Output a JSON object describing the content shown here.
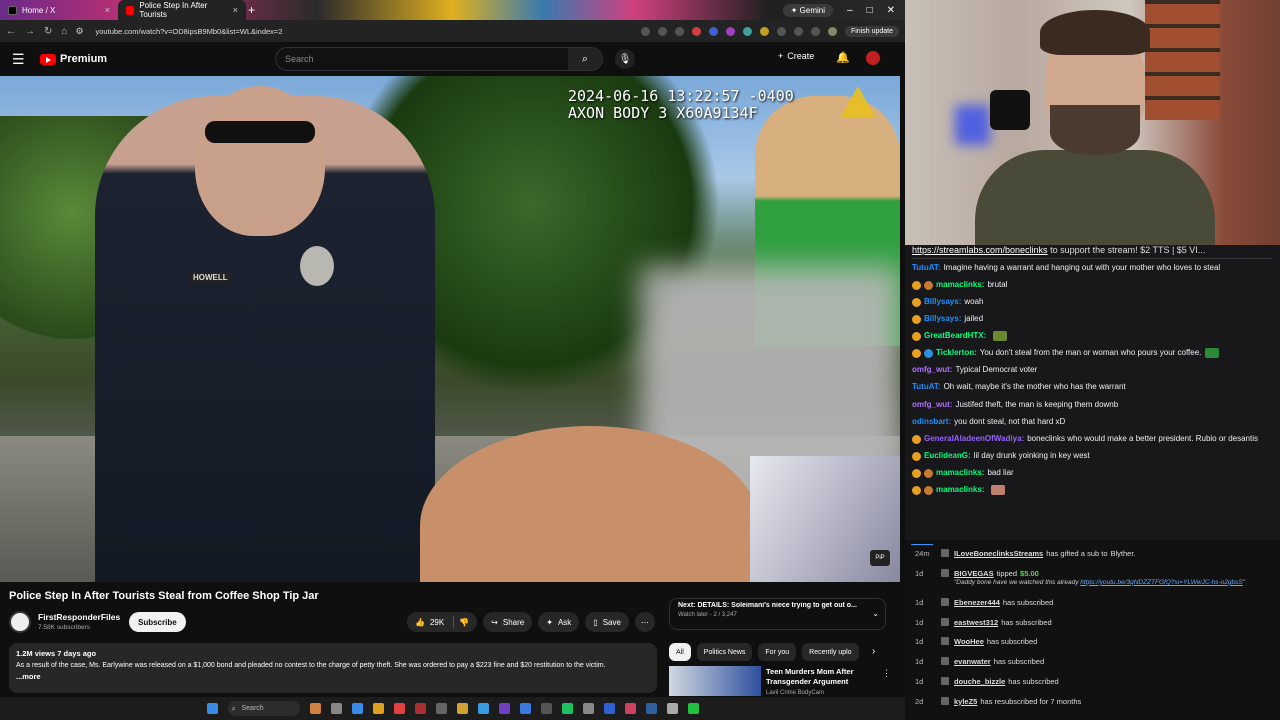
{
  "browser": {
    "tabs": [
      {
        "label": "Home / X"
      },
      {
        "label": "Police Step In After Tourists"
      }
    ],
    "gemini_label": "Gemini",
    "url": "youtube.com/watch?v=OD8ipsB9Mb0&list=WL&index=2",
    "finish_update": "Finish update"
  },
  "youtube": {
    "logo_text": "Premium",
    "search_placeholder": "Search",
    "create_label": "Create",
    "video": {
      "timestamp_line1": "2024-06-16 13:22:57 -0400",
      "timestamp_line2": "AXON BODY 3 X60A9134F",
      "name_tag": "HOWELL",
      "pip_label": "PiP",
      "title": "Police Step In After Tourists Steal from Coffee Shop Tip Jar",
      "channel": "FirstResponderFiles",
      "subscribers": "7.58K subscribers",
      "subscribe_label": "Subscribe",
      "likes": "29K",
      "share_label": "Share",
      "ask_label": "Ask",
      "save_label": "Save",
      "views_date": "1.2M views  7 days ago",
      "description": "As a result of the case, Ms. Earlywine was released on a $1,000 bond and pleaded no contest to the charge of petty theft. She was ordered to pay a $223 fine and $20 restitution to the victim.",
      "more_label": "...more"
    },
    "next": {
      "title": "Next: DETAILS: Soleimani's niece trying to get out o...",
      "sub": "Watch later - 2 / 3,247"
    },
    "chips": [
      "All",
      "Politics News",
      "For you",
      "Recently uplo"
    ],
    "suggested": {
      "title": "Teen Murders Mom After Transgender Argument",
      "channel": "Lavil Crime BodyCam"
    }
  },
  "taskbar": {
    "search_label": "Search"
  },
  "chat": {
    "pinned_link": "https://streamlabs.com/boneclinks",
    "pinned_text": " to support the stream! $2 TTS | $5 VI...",
    "messages": [
      {
        "user": "TutuAT:",
        "color": "#1e90ff",
        "text": "Imagine having a warrant and hanging out with your mother who loves to steal",
        "badges": 0
      },
      {
        "user": "mamaclinks:",
        "color": "#00ff7f",
        "text": "brutal",
        "badges": 2
      },
      {
        "user": "Billysays:",
        "color": "#1e90ff",
        "text": "woah",
        "badges": 1
      },
      {
        "user": "Billysays:",
        "color": "#1e90ff",
        "text": "jailed",
        "badges": 1
      },
      {
        "user": "GreatBeardHTX:",
        "color": "#00ff7f",
        "text": "",
        "badges": 1,
        "emote": "#6a8a30"
      },
      {
        "user": "Ticklerton:",
        "color": "#00ff7f",
        "text": "You don't steal from the man or woman who pours your coffee.",
        "badges": 2,
        "emote": "#2a8a3a"
      },
      {
        "user": "omfg_wut:",
        "color": "#b070ff",
        "text": "Typical Democrat voter",
        "badges": 0
      },
      {
        "user": "TutuAT:",
        "color": "#1e90ff",
        "text": "Oh wait, maybe it's the mother who has the warrant",
        "badges": 0
      },
      {
        "user": "omfg_wut:",
        "color": "#b070ff",
        "text": "Justifed theft, the man is keeping them downb",
        "badges": 0
      },
      {
        "user": "odinsbart:",
        "color": "#1e90ff",
        "text": "you dont steal, not that hard xD",
        "badges": 0
      },
      {
        "user": "GeneralAladeenOfWadiya:",
        "color": "#9a60ff",
        "text": "boneclinks who would make a better president. Rubio or desantis",
        "badges": 1
      },
      {
        "user": "EuclideanG:",
        "color": "#00ff7f",
        "text": "lil day drunk yoinking in key west",
        "badges": 1
      },
      {
        "user": "mamaclinks:",
        "color": "#00ff7f",
        "text": "bad liar",
        "badges": 2
      },
      {
        "user": "mamaclinks:",
        "color": "#00ff7f",
        "text": "",
        "badges": 2,
        "emote": "#c08070"
      }
    ]
  },
  "events": [
    {
      "time": "24m",
      "name": "ILoveBoneclinksStreams",
      "text": "has gifted a sub to",
      "extra": "Blyther."
    },
    {
      "time": "1d",
      "name": "BIGVEGAS",
      "text": "tipped",
      "amount": "$5.00",
      "quote_pre": "\"Daddy bone have we watched this already ",
      "quote_link": "https://youtu.be/3qNDZZTFGfQ?si=YLWwJC-hs-o2gbsS",
      "quote_post": "\""
    },
    {
      "time": "1d",
      "name": "Ebenezer444",
      "text": "has subscribed"
    },
    {
      "time": "1d",
      "name": "eastwest312",
      "text": "has subscribed"
    },
    {
      "time": "1d",
      "name": "WooHee",
      "text": "has subscribed"
    },
    {
      "time": "1d",
      "name": "evanwater",
      "text": "has subscribed"
    },
    {
      "time": "1d",
      "name": "douche_bizzle",
      "text": "has subscribed"
    },
    {
      "time": "2d",
      "name": "kyleZ5",
      "text": "has resubscribed for 7 months"
    }
  ]
}
